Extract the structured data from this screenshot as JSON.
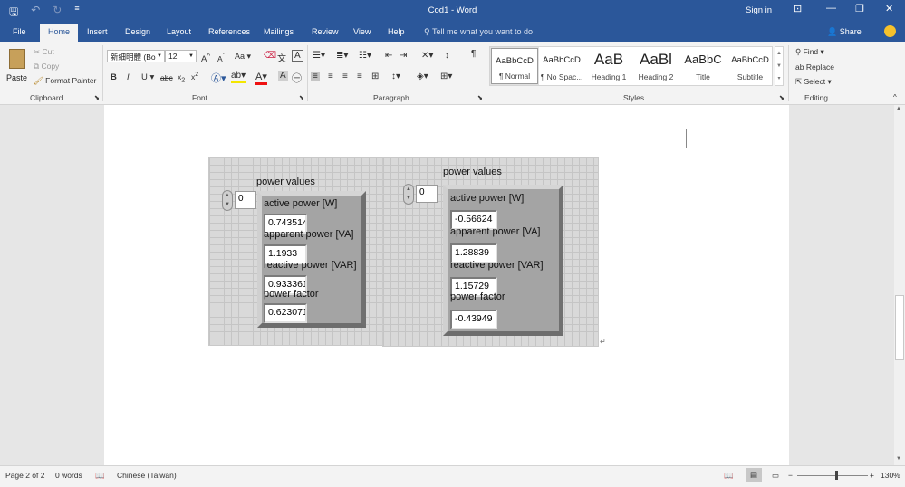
{
  "window": {
    "title": "Cod1  -  Word",
    "sign_in": "Sign in"
  },
  "ribbon_tabs": [
    "File",
    "Home",
    "Insert",
    "Design",
    "Layout",
    "References",
    "Mailings",
    "Review",
    "View",
    "Help"
  ],
  "active_tab": "Home",
  "tell_me": "Tell me what you want to do",
  "share": "Share",
  "clipboard": {
    "paste": "Paste",
    "cut": "Cut",
    "copy": "Copy",
    "format_painter": "Format Painter",
    "group": "Clipboard"
  },
  "font": {
    "name": "新細明體 (Bo",
    "size": "12",
    "group": "Font"
  },
  "paragraph": {
    "group": "Paragraph"
  },
  "styles": {
    "group": "Styles",
    "items": [
      {
        "preview": "AaBbCcD",
        "name": "¶ Normal"
      },
      {
        "preview": "AaBbCcD",
        "name": "¶ No Spac..."
      },
      {
        "preview": "AaB",
        "name": "Heading 1"
      },
      {
        "preview": "AaBl",
        "name": "Heading 2"
      },
      {
        "preview": "AaBbC",
        "name": "Title"
      },
      {
        "preview": "AaBbCcD",
        "name": "Subtitle"
      }
    ]
  },
  "editing": {
    "find": "Find",
    "replace": "Replace",
    "select": "Select",
    "group": "Editing"
  },
  "panels": [
    {
      "title": "power values",
      "index": "0",
      "fields": [
        {
          "label": "active power [W]",
          "value": "0.743514"
        },
        {
          "label": "apparent power [VA]",
          "value": "1.1933"
        },
        {
          "label": "reactive power [VAR]",
          "value": "0.933361"
        },
        {
          "label": "power factor",
          "value": "0.623071"
        }
      ]
    },
    {
      "title": "power values",
      "index": "0",
      "fields": [
        {
          "label": "active power [W]",
          "value": "-0.56624"
        },
        {
          "label": "apparent power [VA]",
          "value": "1.28839"
        },
        {
          "label": "reactive power [VAR]",
          "value": "1.15729"
        },
        {
          "label": "power factor",
          "value": "-0.43949"
        }
      ]
    }
  ],
  "status": {
    "page": "Page 2 of 2",
    "words": "0 words",
    "language": "Chinese (Taiwan)",
    "zoom": "130%"
  }
}
